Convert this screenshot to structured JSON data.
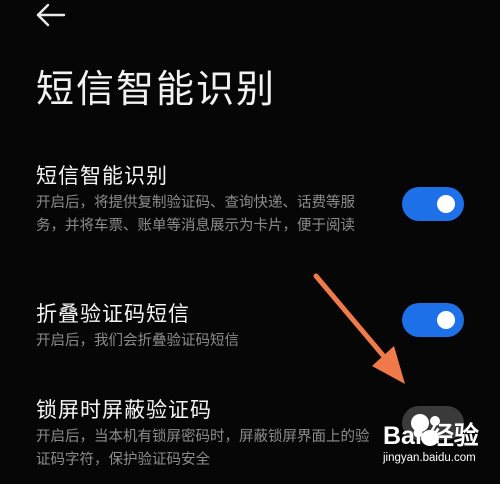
{
  "header": {
    "back_icon": "arrow-left-icon",
    "title": "短信智能识别"
  },
  "settings": [
    {
      "title": "短信智能识别",
      "description": "开启后，将提供复制验证码、查询快递、话费等服务，并将车票、账单等消息展示为卡片，便于阅读",
      "enabled": true
    },
    {
      "title": "折叠验证码短信",
      "description": "开启后，我们会折叠验证码短信",
      "enabled": true
    },
    {
      "title": "锁屏时屏蔽验证码",
      "description": "开启后，当本机有锁屏密码时，屏蔽锁屏界面上的验证码字符，保护验证码安全",
      "enabled": false
    }
  ],
  "watermark": {
    "brand": "Bai 经验",
    "url": "jingyan.baidu.com"
  },
  "colors": {
    "background": "#060606",
    "toggle_on": "#1d70e8",
    "toggle_off": "#3a3a3a",
    "annotation_arrow": "#f07a4a"
  }
}
